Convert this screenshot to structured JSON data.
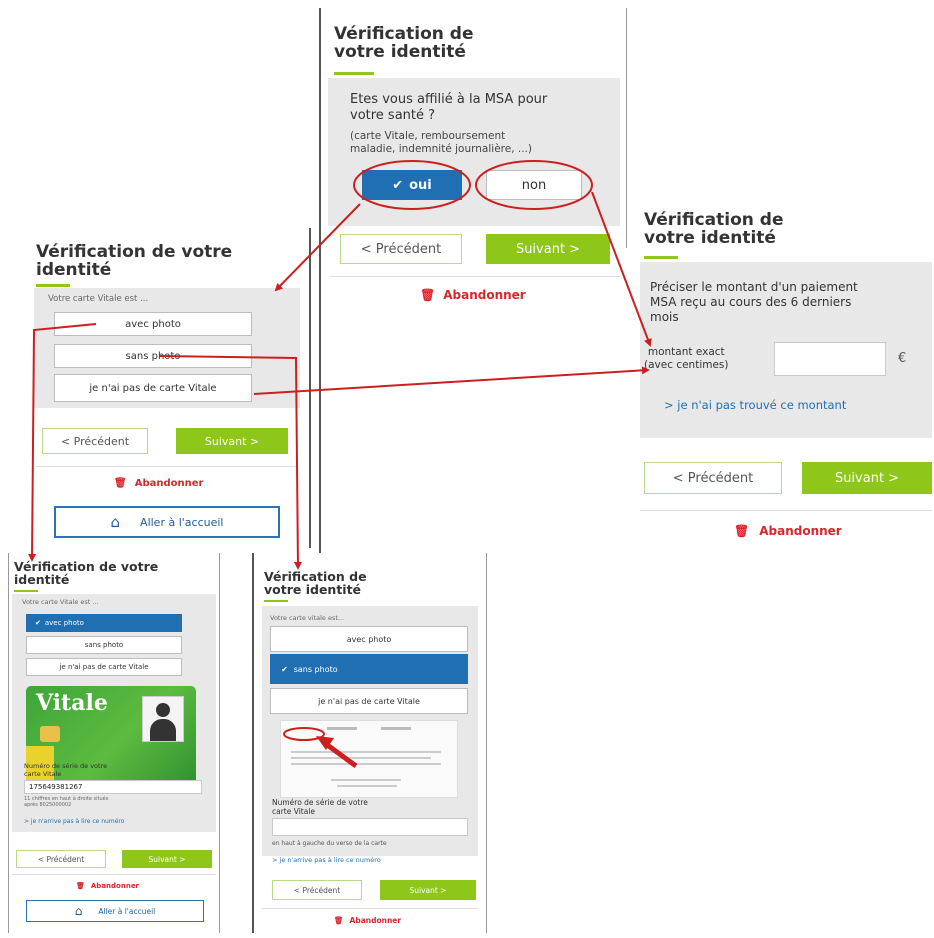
{
  "colors": {
    "accent_green": "#8ec61a",
    "brand_blue": "#1f6fb2",
    "danger_red": "#d9262b",
    "annotation_red": "#cc1f1f",
    "panel_gray": "#e8e8e8"
  },
  "icons": {
    "trash": "trash-icon",
    "home": "home-icon",
    "check": "check-icon",
    "chevron_left": "chevron-left-icon",
    "chevron_right": "chevron-right-icon"
  },
  "p1": {
    "title_line1": "Vérification de",
    "title_line2": "votre identité",
    "question_line1": "Etes vous affilié à la MSA pour",
    "question_line2": "votre santé ?",
    "hint_line1": "(carte Vitale, remboursement",
    "hint_line2": "maladie, indemnité journalière, ...)",
    "oui": "oui",
    "non": "non",
    "prev": "< Précédent",
    "next": "Suivant >",
    "abandon": "Abandonner"
  },
  "p2": {
    "title_line1": "Vérification de votre",
    "title_line2": "identité",
    "label": "Votre carte Vitale est ...",
    "opt1": "avec photo",
    "opt2": "sans photo",
    "opt3": "je n'ai pas de carte Vitale",
    "prev": "< Précédent",
    "next": "Suivant >",
    "abandon": "Abandonner",
    "home": "Aller à l'accueil"
  },
  "p3": {
    "title_line1": "Vérification de",
    "title_line2": "votre identité",
    "text_line1": "Préciser le montant d'un paiement",
    "text_line2": "MSA reçu au cours des 6 derniers",
    "text_line3": "mois",
    "amount_label1": "montant exact",
    "amount_label2": "(avec centimes)",
    "currency": "€",
    "link": "> je n'ai pas trouvé ce montant",
    "prev": "< Précédent",
    "next": "Suivant >",
    "abandon": "Abandonner"
  },
  "p4": {
    "title_line1": "Vérification de votre",
    "title_line2": "identité",
    "label": "Votre carte Vitale est ...",
    "opt1": "avec photo",
    "opt2": "sans photo",
    "opt3": "je n'ai pas de carte Vitale",
    "card_brand": "Vitale",
    "serial_label1": "Numéro de série de votre",
    "serial_label2": "carte Vitale",
    "serial_value": "175649381267",
    "help1": "11 chiffres en haut à droite situés",
    "help2": "après 8025000002",
    "link": "> je n'arrive pas à lire ce numéro",
    "prev": "< Précédent",
    "next": "Suivant >",
    "abandon": "Abandonner",
    "home": "Aller à l'accueil"
  },
  "p5": {
    "title_line1": "Vérification de",
    "title_line2": "votre identité",
    "label": "Votre carte vitale est...",
    "opt1": "avec photo",
    "opt2": "sans photo",
    "opt3": "je n'ai pas de carte Vitale",
    "serial_label1": "Numéro de série de votre",
    "serial_label2": "carte Vitale",
    "help": "en haut à gauche du verso de la carte",
    "link": "> je n'arrive pas à lire ce numéro",
    "prev": "< Précédent",
    "next": "Suivant >",
    "abandon": "Abandonner"
  }
}
